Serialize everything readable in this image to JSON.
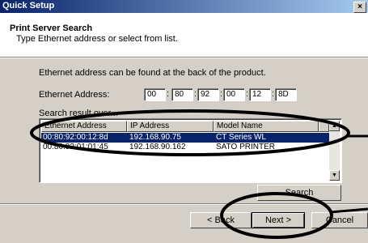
{
  "window": {
    "title": "Quick Setup",
    "close_label": "×"
  },
  "header": {
    "title": "Print Server Search",
    "subtitle": "Type Ethernet address or select from list."
  },
  "info_text": "Ethernet address can be found at the back of the product.",
  "ethernet": {
    "label": "Ethernet Address:",
    "octets": [
      "00",
      "80",
      "92",
      "00",
      "12",
      "8D"
    ]
  },
  "results": {
    "group_label": "Search result over...",
    "columns": [
      "Ethernet Address",
      "IP Address",
      "Model Name"
    ],
    "rows": [
      [
        "00:80:92:00:12:8d",
        "192.168.90.75",
        "CT Series WL"
      ],
      [
        "00:80:92:01:01:45",
        "192.168.90.162",
        "SATO PRINTER"
      ]
    ],
    "selected_row": 0
  },
  "buttons": {
    "search": "Search",
    "back": "< Back",
    "next": "Next >",
    "cancel": "Cancel"
  },
  "colors": {
    "selection": "#0a246a",
    "annotation": "#000000"
  }
}
